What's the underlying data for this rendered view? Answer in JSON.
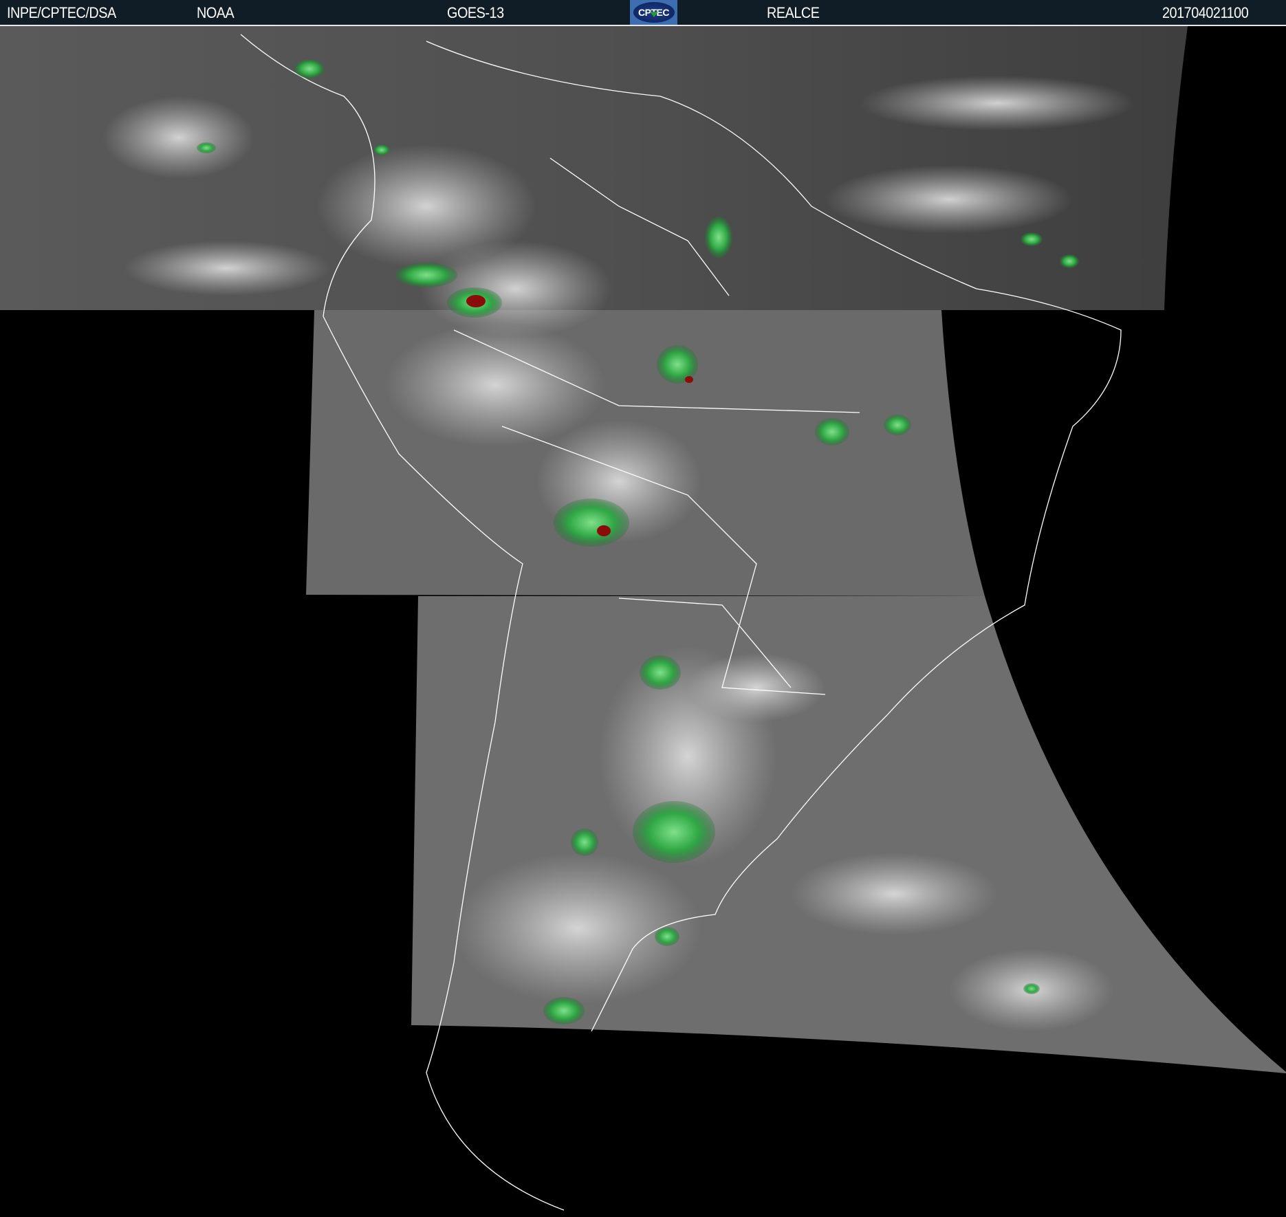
{
  "header": {
    "agency": "INPE/CPTEC/DSA",
    "provider": "NOAA",
    "satellite": "GOES-13",
    "logo_text": "CPTEC",
    "product": "REALCE",
    "timestamp": "201704021100"
  },
  "colors": {
    "header_bg": "#111d26",
    "cloud_gray": "#7a7a7a",
    "convection_green": "#2fa844",
    "deep_convection_red": "#8b0a0a",
    "background": "#000000"
  }
}
